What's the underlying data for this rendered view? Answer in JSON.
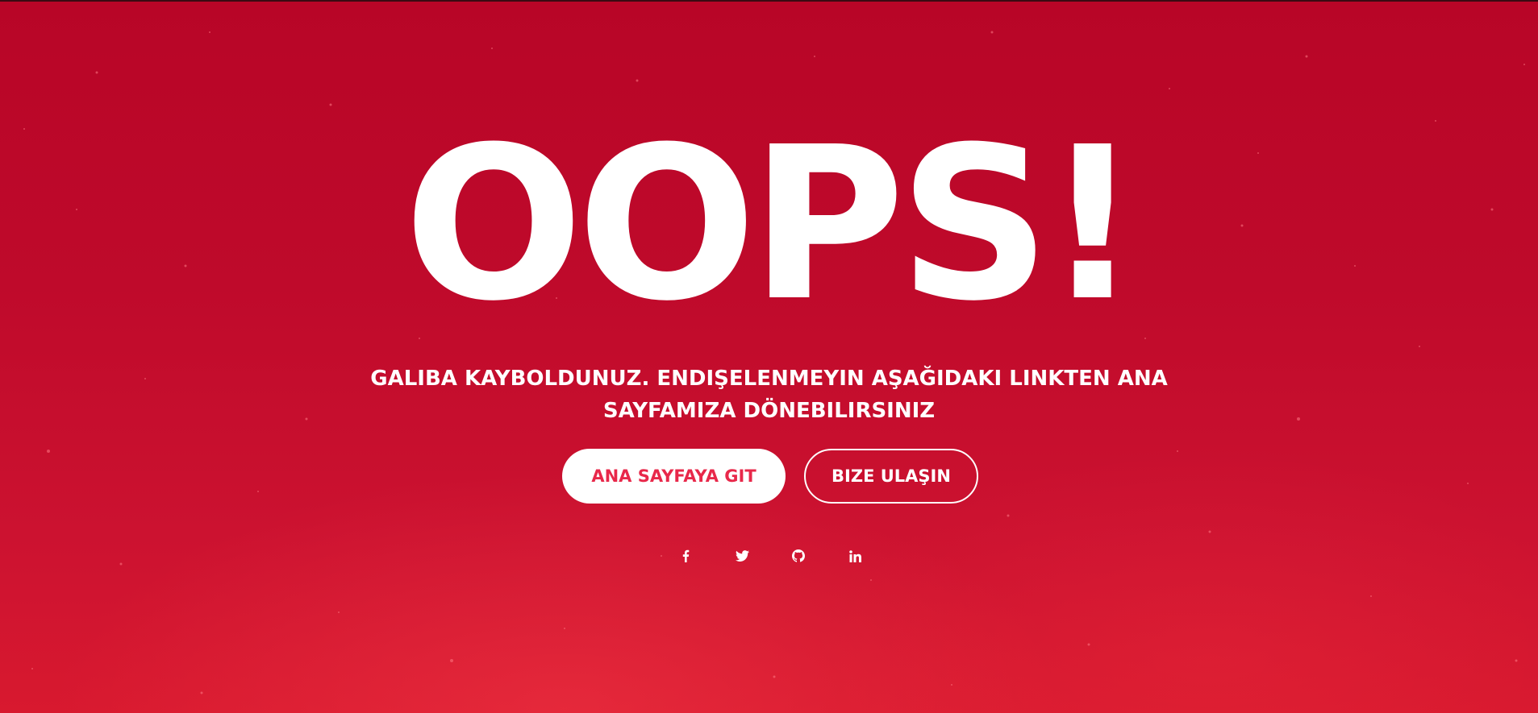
{
  "page": {
    "heading": "OOPS!",
    "message": "GALIBA KAYBOLDUNUZ. ENDIŞELENMEYIN AŞAĞIDAKI LINKTEN ANA SAYFAMIZA DÖNEBILIRSINIZ"
  },
  "buttons": {
    "home_label": "ANA SAYFAYA GIT",
    "contact_label": "BIZE ULAŞIN"
  },
  "social_links": [
    {
      "icon": "facebook-icon"
    },
    {
      "icon": "twitter-icon"
    },
    {
      "icon": "github-icon"
    },
    {
      "icon": "linkedin-icon"
    }
  ],
  "colors": {
    "background": "#bf0a2b",
    "accent_text": "#e8284a",
    "foreground": "#ffffff"
  }
}
